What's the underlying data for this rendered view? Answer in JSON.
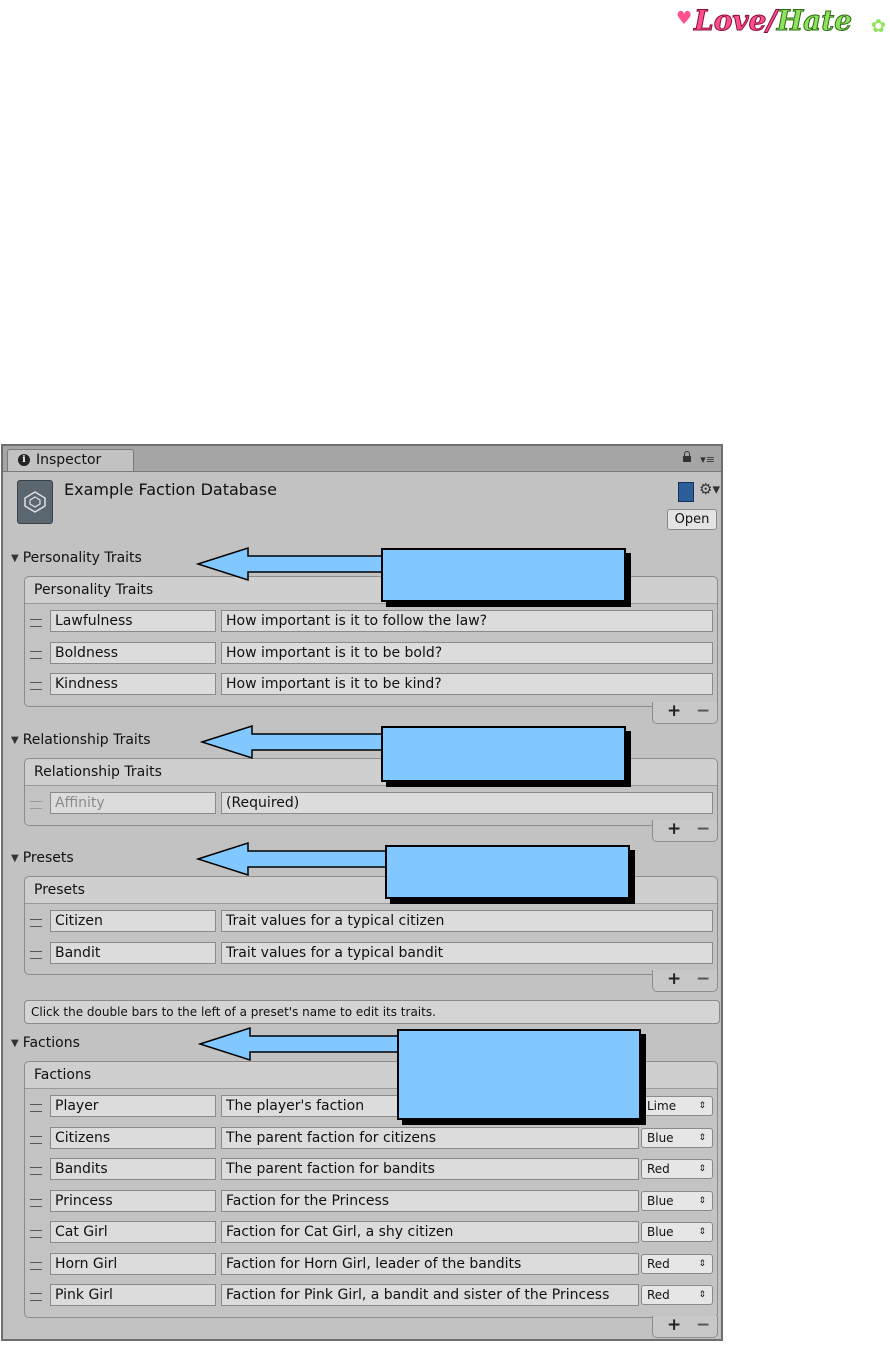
{
  "logo": {
    "love": "Love",
    "hate": "Hate"
  },
  "inspector": {
    "tab_label": "Inspector",
    "asset_title": "Example Faction Database",
    "open_label": "Open"
  },
  "sections": {
    "personality": {
      "fold_label": "Personality Traits",
      "list_header": "Personality Traits",
      "rows": [
        {
          "name": "Lawfulness",
          "desc": "How important is it to follow the law?"
        },
        {
          "name": "Boldness",
          "desc": "How important is it to be bold?"
        },
        {
          "name": "Kindness",
          "desc": "How important is it to be kind?"
        }
      ]
    },
    "relationship": {
      "fold_label": "Relationship Traits",
      "list_header": "Relationship Traits",
      "rows": [
        {
          "name": "Affinity",
          "desc": "(Required)"
        }
      ]
    },
    "presets": {
      "fold_label": "Presets",
      "list_header": "Presets",
      "rows": [
        {
          "name": "Citizen",
          "desc": "Trait values for a typical citizen"
        },
        {
          "name": "Bandit",
          "desc": "Trait values for a typical bandit"
        }
      ],
      "help": "Click the double bars to the left of a preset's name to edit its traits."
    },
    "factions": {
      "fold_label": "Factions",
      "list_header": "Factions",
      "rows": [
        {
          "name": "Player",
          "desc": "The player's faction",
          "color": "Lime"
        },
        {
          "name": "Citizens",
          "desc": "The parent faction for citizens",
          "color": "Blue"
        },
        {
          "name": "Bandits",
          "desc": "The parent faction for bandits",
          "color": "Red"
        },
        {
          "name": "Princess",
          "desc": "Faction for the Princess",
          "color": "Blue"
        },
        {
          "name": "Cat Girl",
          "desc": "Faction for Cat Girl, a shy citizen",
          "color": "Blue"
        },
        {
          "name": "Horn Girl",
          "desc": "Faction for Horn Girl, leader of the bandits",
          "color": "Red"
        },
        {
          "name": "Pink Girl",
          "desc": "Faction for Pink Girl, a bandit and sister of the Princess",
          "color": "Red"
        }
      ]
    }
  },
  "list_controls": {
    "add": "+",
    "remove": "−"
  },
  "colors": {
    "callout_fill": "#80c8ff",
    "panel_bg": "#c2c2c2"
  }
}
